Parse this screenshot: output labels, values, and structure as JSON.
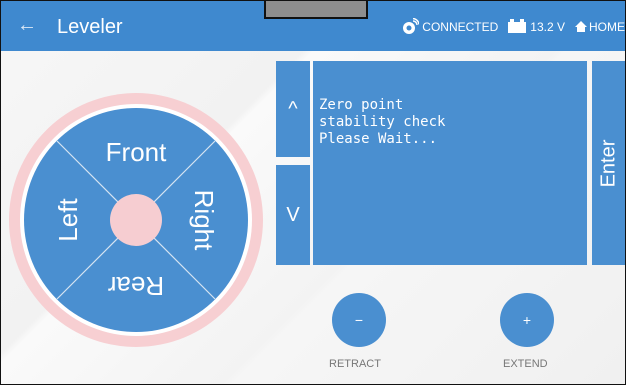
{
  "header": {
    "back_icon": "←",
    "title": "Leveler",
    "connected": "CONNECTED",
    "voltage": "13.2 V",
    "home": "HOME"
  },
  "dial": {
    "front": "Front",
    "left": "Left",
    "right": "Right",
    "rear": "Rear"
  },
  "controls": {
    "up": "^",
    "down": "V",
    "enter": "Enter",
    "retract_symbol": "−",
    "extend_symbol": "+",
    "retract": "RETRACT",
    "extend": "EXTEND"
  },
  "display": {
    "message": "Zero point\nstability check\nPlease Wait..."
  },
  "colors": {
    "accent": "#4a8fd0",
    "header": "#3f89cf",
    "ring": "#f7cfd2"
  }
}
